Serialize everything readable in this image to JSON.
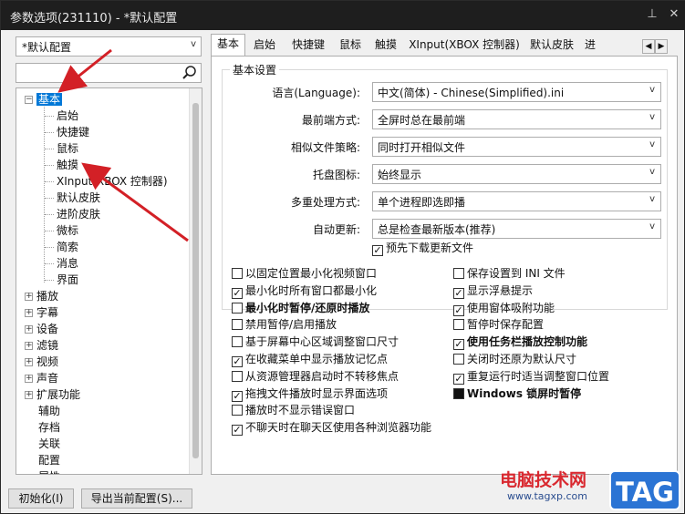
{
  "window": {
    "title": "参数选项(231110) - *默认配置"
  },
  "sidebar": {
    "preset": "*默认配置",
    "search_placeholder": "",
    "tree": [
      {
        "label": "基本",
        "expanded": true,
        "selected": true
      },
      {
        "label": "启始"
      },
      {
        "label": "快捷键"
      },
      {
        "label": "鼠标"
      },
      {
        "label": "触摸"
      },
      {
        "label": "XInput(XBOX 控制器)"
      },
      {
        "label": "默认皮肤"
      },
      {
        "label": "进阶皮肤"
      },
      {
        "label": "微标"
      },
      {
        "label": "简索"
      },
      {
        "label": "消息"
      },
      {
        "label": "界面"
      },
      {
        "label": "播放",
        "collapsed": true
      },
      {
        "label": "字幕",
        "collapsed": true
      },
      {
        "label": "设备",
        "collapsed": true
      },
      {
        "label": "滤镜",
        "collapsed": true
      },
      {
        "label": "视频",
        "collapsed": true
      },
      {
        "label": "声音",
        "collapsed": true
      },
      {
        "label": "扩展功能",
        "collapsed": true
      },
      {
        "label": "辅助"
      },
      {
        "label": "存档"
      },
      {
        "label": "关联"
      },
      {
        "label": "配置"
      },
      {
        "label": "属性"
      }
    ]
  },
  "buttons": {
    "init": "初始化(I)",
    "export": "导出当前配置(S)..."
  },
  "tabs": [
    "基本",
    "启始",
    "快捷键",
    "鼠标",
    "触摸",
    "XInput(XBOX 控制器)",
    "默认皮肤",
    "进"
  ],
  "basic": {
    "group_title": "基本设置",
    "fields": [
      {
        "label": "语言(Language):",
        "value": "中文(简体) - Chinese(Simplified).ini"
      },
      {
        "label": "最前端方式:",
        "value": "全屏时总在最前端"
      },
      {
        "label": "相似文件策略:",
        "value": "同时打开相似文件"
      },
      {
        "label": "托盘图标:",
        "value": "始终显示"
      },
      {
        "label": "多重处理方式:",
        "value": "单个进程即选即播"
      },
      {
        "label": "自动更新:",
        "value": "总是检查最新版本(推荐)"
      }
    ],
    "predownload": {
      "label": "预先下载更新文件",
      "checked": true
    }
  },
  "options_left": [
    {
      "label": "以固定位置最小化视频窗口",
      "state": "off"
    },
    {
      "label": "最小化时所有窗口都最小化",
      "state": "on"
    },
    {
      "label": "最小化时暂停/还原时播放",
      "state": "off",
      "bold": true
    },
    {
      "label": "禁用暂停/启用播放",
      "state": "off"
    },
    {
      "label": "基于屏幕中心区域调整窗口尺寸",
      "state": "off"
    },
    {
      "label": "在收藏菜单中显示播放记忆点",
      "state": "on"
    },
    {
      "label": "从资源管理器启动时不转移焦点",
      "state": "off"
    },
    {
      "label": "拖拽文件播放时显示界面选项",
      "state": "on"
    },
    {
      "label": "播放时不显示错误窗口",
      "state": "off"
    },
    {
      "label": "不聊天时在聊天区使用各种浏览器功能",
      "state": "on"
    }
  ],
  "options_right": [
    {
      "label": "保存设置到 INI 文件",
      "state": "off"
    },
    {
      "label": "显示浮悬提示",
      "state": "on"
    },
    {
      "label": "使用窗体吸附功能",
      "state": "on"
    },
    {
      "label": "暂停时保存配置",
      "state": "off"
    },
    {
      "label": "使用任务栏播放控制功能",
      "state": "on",
      "bold": true
    },
    {
      "label": "关闭时还原为默认尺寸",
      "state": "off"
    },
    {
      "label": "重复运行时适当调整窗口位置",
      "state": "on"
    },
    {
      "label": "Windows 锁屏时暂停",
      "state": "filled",
      "bold": true
    }
  ],
  "watermark": {
    "text": "电脑技术网",
    "url": "www.tagxp.com",
    "tag": "TAG"
  },
  "colors": {
    "selection": "#0078d7",
    "arrow": "#d32026",
    "titlebar": "#1e1e1e"
  }
}
